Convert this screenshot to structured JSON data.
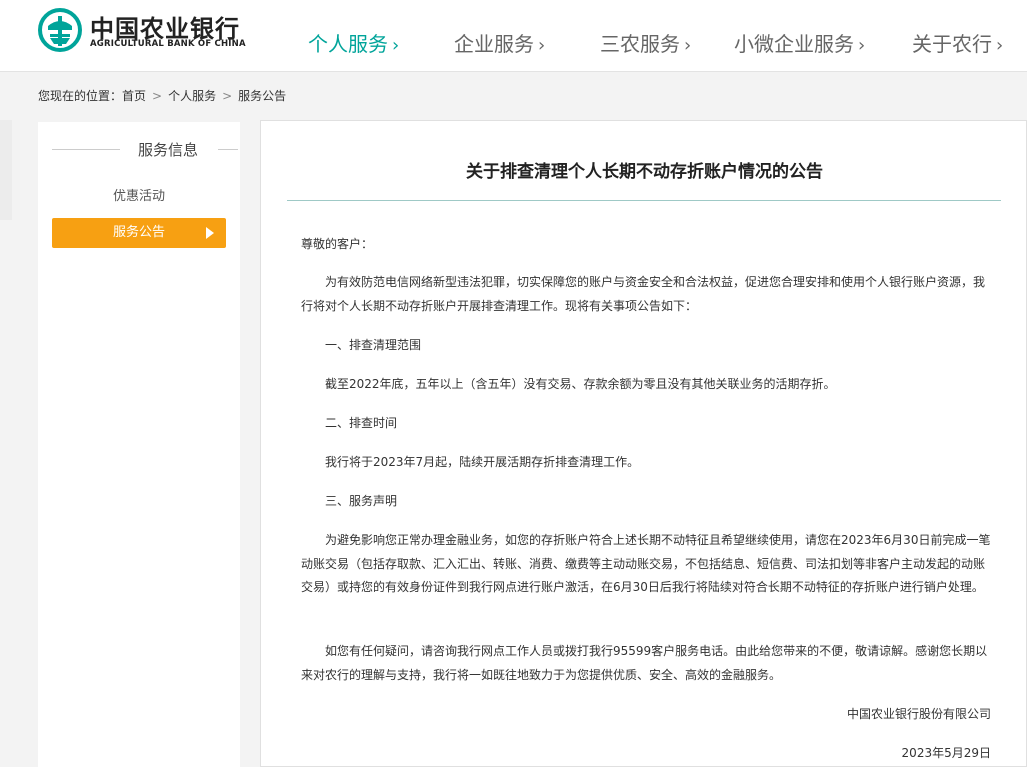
{
  "header": {
    "logo_cn": "中国农业银行",
    "logo_en": "AGRICULTURAL BANK OF CHINA",
    "brand_color": "#00a49a",
    "nav": [
      {
        "label": "个人服务",
        "active": true
      },
      {
        "label": "企业服务",
        "active": false
      },
      {
        "label": "三农服务",
        "active": false
      },
      {
        "label": "小微企业服务",
        "active": false
      },
      {
        "label": "关于农行",
        "active": false
      }
    ],
    "nav_chevron": "›"
  },
  "breadcrumb": {
    "prefix": "您现在的位置：",
    "items": [
      "首页",
      "个人服务",
      "服务公告"
    ],
    "separator": ">"
  },
  "sidebar": {
    "title": "服务信息",
    "items": [
      {
        "label": "优惠活动",
        "active": false
      },
      {
        "label": "服务公告",
        "active": true
      }
    ],
    "active_color": "#f7a012"
  },
  "article": {
    "title": "关于排查清理个人长期不动存折账户情况的公告",
    "greeting": "尊敬的客户：",
    "intro": "为有效防范电信网络新型违法犯罪，切实保障您的账户与资金安全和合法权益，促进您合理安排和使用个人银行账户资源，我行将对个人长期不动存折账户开展排查清理工作。现将有关事项公告如下：",
    "section1_heading": "一、排查清理范围",
    "section1_text": "截至2022年底，五年以上（含五年）没有交易、存款余额为零且没有其他关联业务的活期存折。",
    "section2_heading": "二、排查时间",
    "section2_text": "我行将于2023年7月起，陆续开展活期存折排查清理工作。",
    "section3_heading": "三、服务声明",
    "section3_text": "为避免影响您正常办理金融业务，如您的存折账户符合上述长期不动特征且希望继续使用，请您在2023年6月30日前完成一笔动账交易（包括存取款、汇入汇出、转账、消费、缴费等主动动账交易，不包括结息、短信费、司法扣划等非客户主动发起的动账交易）或持您的有效身份证件到我行网点进行账户激活，在6月30日后我行将陆续对符合长期不动特征的存折账户进行销户处理。",
    "closing": "如您有任何疑问，请咨询我行网点工作人员或拨打我行95599客户服务电话。由此给您带来的不便，敬请谅解。感谢您长期以来对农行的理解与支持，我行将一如既往地致力于为您提供优质、安全、高效的金融服务。",
    "signature": "中国农业银行股份有限公司",
    "date": "2023年5月29日"
  }
}
